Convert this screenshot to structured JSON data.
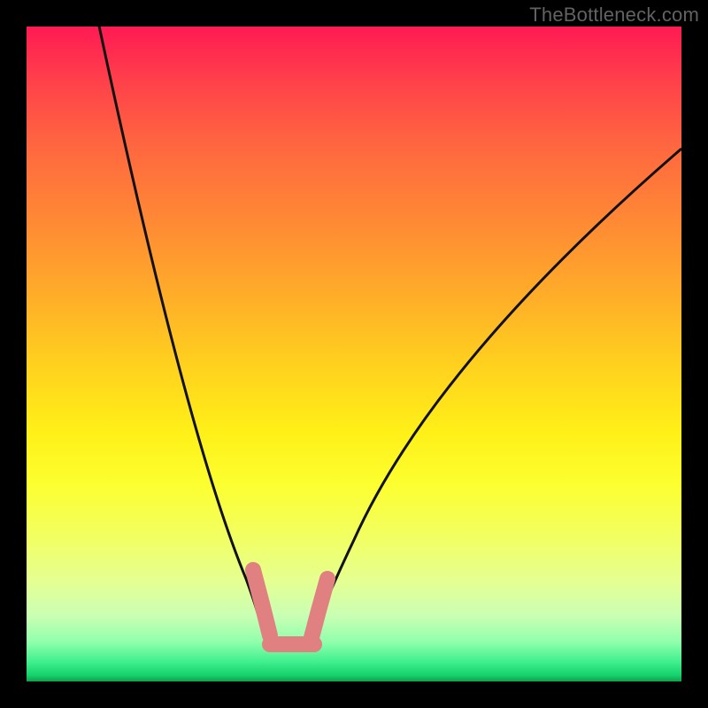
{
  "watermark": "TheBottleneck.com",
  "chart_data": {
    "type": "line",
    "title": "",
    "xlabel": "",
    "ylabel": "",
    "description": "Bottleneck V-curve on vertical rainbow gradient (red=high bottleneck, green=balanced). Two black curves descend from top to a minimum near x≈0.39 then rise to the right; the minimum/floor region is highlighted in pink.",
    "x_range_normalized": [
      0,
      1
    ],
    "y_range_normalized": [
      0,
      1
    ],
    "gradient_stops": [
      {
        "pos": 0.0,
        "color": "#ff1a53",
        "meaning": "severe bottleneck"
      },
      {
        "pos": 0.5,
        "color": "#ffd21e",
        "meaning": "moderate"
      },
      {
        "pos": 0.95,
        "color": "#40ef8e",
        "meaning": "balanced"
      },
      {
        "pos": 1.0,
        "color": "#0fa24f",
        "meaning": "optimal"
      }
    ],
    "series": [
      {
        "name": "left-curve",
        "x": [
          0.11,
          0.17,
          0.23,
          0.29,
          0.33,
          0.36,
          0.37
        ],
        "y": [
          1.01,
          0.72,
          0.45,
          0.25,
          0.13,
          0.07,
          0.05
        ]
      },
      {
        "name": "right-curve",
        "x": [
          0.44,
          0.47,
          0.52,
          0.6,
          0.72,
          0.86,
          1.0
        ],
        "y": [
          0.06,
          0.1,
          0.18,
          0.32,
          0.52,
          0.7,
          0.81
        ]
      },
      {
        "name": "highlight-sweet-spot",
        "x": [
          0.35,
          0.37,
          0.4,
          0.44,
          0.46
        ],
        "y": [
          0.17,
          0.07,
          0.055,
          0.06,
          0.16
        ],
        "color": "#e08080",
        "stroke_width_px": 18
      }
    ],
    "minimum_point": {
      "x": 0.4,
      "y": 0.055
    },
    "grid": false,
    "legend": null
  }
}
